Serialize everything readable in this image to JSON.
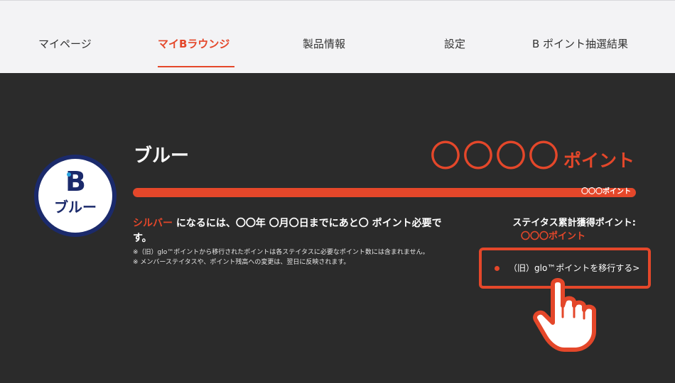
{
  "nav": {
    "items": [
      {
        "label": "マイページ"
      },
      {
        "label": "マイBラウンジ"
      },
      {
        "label": "製品情報"
      },
      {
        "label": "設定"
      },
      {
        "label": "B ポイント抽選結果"
      }
    ],
    "active_index": 1
  },
  "tier": {
    "badge_letter": "B",
    "badge_label": "ブルー",
    "name": "ブルー"
  },
  "points": {
    "value": "〇〇〇〇",
    "unit": "ポイント"
  },
  "progress": {
    "fill_fraction": 1.0,
    "label": "〇〇〇ポイント"
  },
  "description": {
    "next_tier": "シルバー",
    "text": " になるには、〇〇年 〇月〇日までにあと〇 ポイント必要です。",
    "note1": "※（旧）glo™ポイントから移行されたポイントは各ステイタスに必要なポイント数には含まれません。",
    "note2": "※ メンバーステイタスや、ポイント残高への変更は、翌日に反映されます。"
  },
  "status": {
    "title": "ステイタス累計獲得ポイント:",
    "value": "〇〇〇ポイント"
  },
  "migrate": {
    "label": "（旧）glo™ポイントを移行する>"
  },
  "colors": {
    "accent": "#e4472a",
    "dark_bg": "#2b2b2b",
    "nav_bg": "#f3f3f5",
    "badge_navy": "#1b2a6b"
  },
  "icons": {
    "hand": "pointing-hand-icon",
    "dot": "bullet-icon"
  }
}
